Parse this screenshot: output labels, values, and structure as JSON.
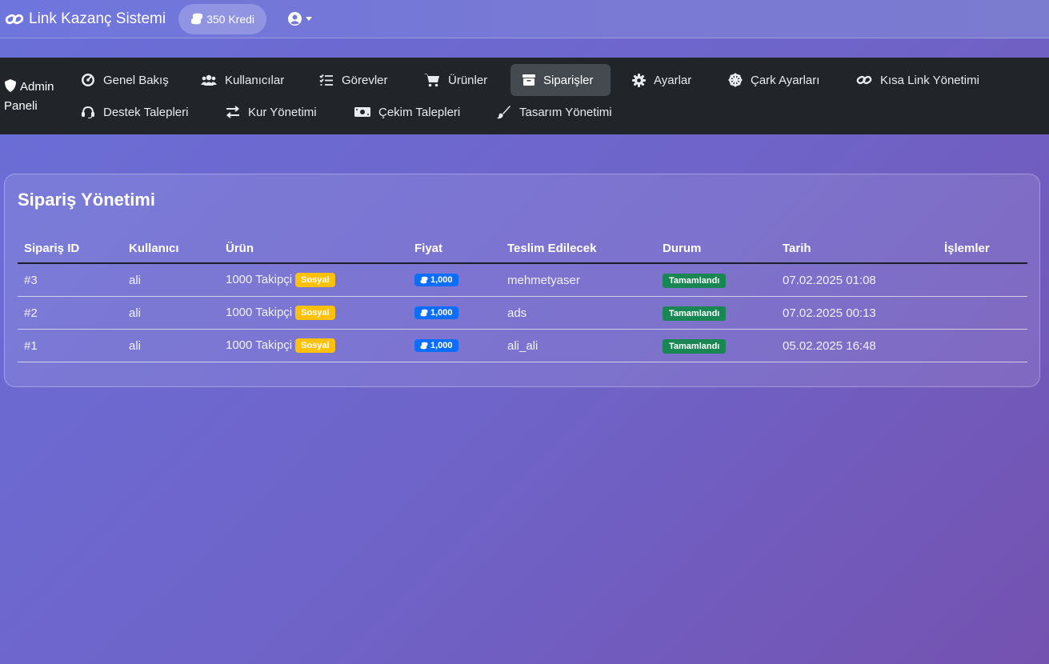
{
  "header": {
    "brand": "Link Kazanç Sistemi",
    "credits": "350 Kredi"
  },
  "admin": {
    "title_line1": "Admin",
    "title_line2": "Paneli"
  },
  "nav": {
    "items": [
      {
        "label": "Genel Bakış",
        "icon": "gauge-icon"
      },
      {
        "label": "Kullanıcılar",
        "icon": "users-icon"
      },
      {
        "label": "Görevler",
        "icon": "tasks-icon"
      },
      {
        "label": "Ürünler",
        "icon": "cart-icon"
      },
      {
        "label": "Siparişler",
        "icon": "box-icon",
        "active": true
      },
      {
        "label": "Ayarlar",
        "icon": "gear-icon"
      },
      {
        "label": "Çark Ayarları",
        "icon": "wheel-icon"
      },
      {
        "label": "Kısa Link Yönetimi",
        "icon": "link-icon"
      },
      {
        "label": "Destek Talepleri",
        "icon": "headset-icon"
      },
      {
        "label": "Kur Yönetimi",
        "icon": "exchange-icon"
      },
      {
        "label": "Çekim Talepleri",
        "icon": "money-icon"
      },
      {
        "label": "Tasarım Yönetimi",
        "icon": "brush-icon"
      }
    ]
  },
  "orders": {
    "title": "Sipariş Yönetimi",
    "columns": [
      "Sipariş ID",
      "Kullanıcı",
      "Ürün",
      "Fiyat",
      "Teslim Edilecek",
      "Durum",
      "Tarih",
      "İşlemler"
    ],
    "rows": [
      {
        "id": "#3",
        "user": "ali",
        "product": "1000 Takipçi",
        "category": "Sosyal",
        "price": "1,000",
        "target": "mehmetyaser",
        "status": "Tamamlandı",
        "date": "07.02.2025 01:08"
      },
      {
        "id": "#2",
        "user": "ali",
        "product": "1000 Takipçi",
        "category": "Sosyal",
        "price": "1,000",
        "target": "ads",
        "status": "Tamamlandı",
        "date": "07.02.2025 00:13"
      },
      {
        "id": "#1",
        "user": "ali",
        "product": "1000 Takipçi",
        "category": "Sosyal",
        "price": "1,000",
        "target": "ali_ali",
        "status": "Tamamlandı",
        "date": "05.02.2025 16:48"
      }
    ]
  },
  "colors": {
    "navbar_bg": "#212529",
    "active_nav_bg": "#454a50",
    "badge_category": "#ffc107",
    "badge_price": "#0d6efd",
    "badge_status": "#198754"
  }
}
